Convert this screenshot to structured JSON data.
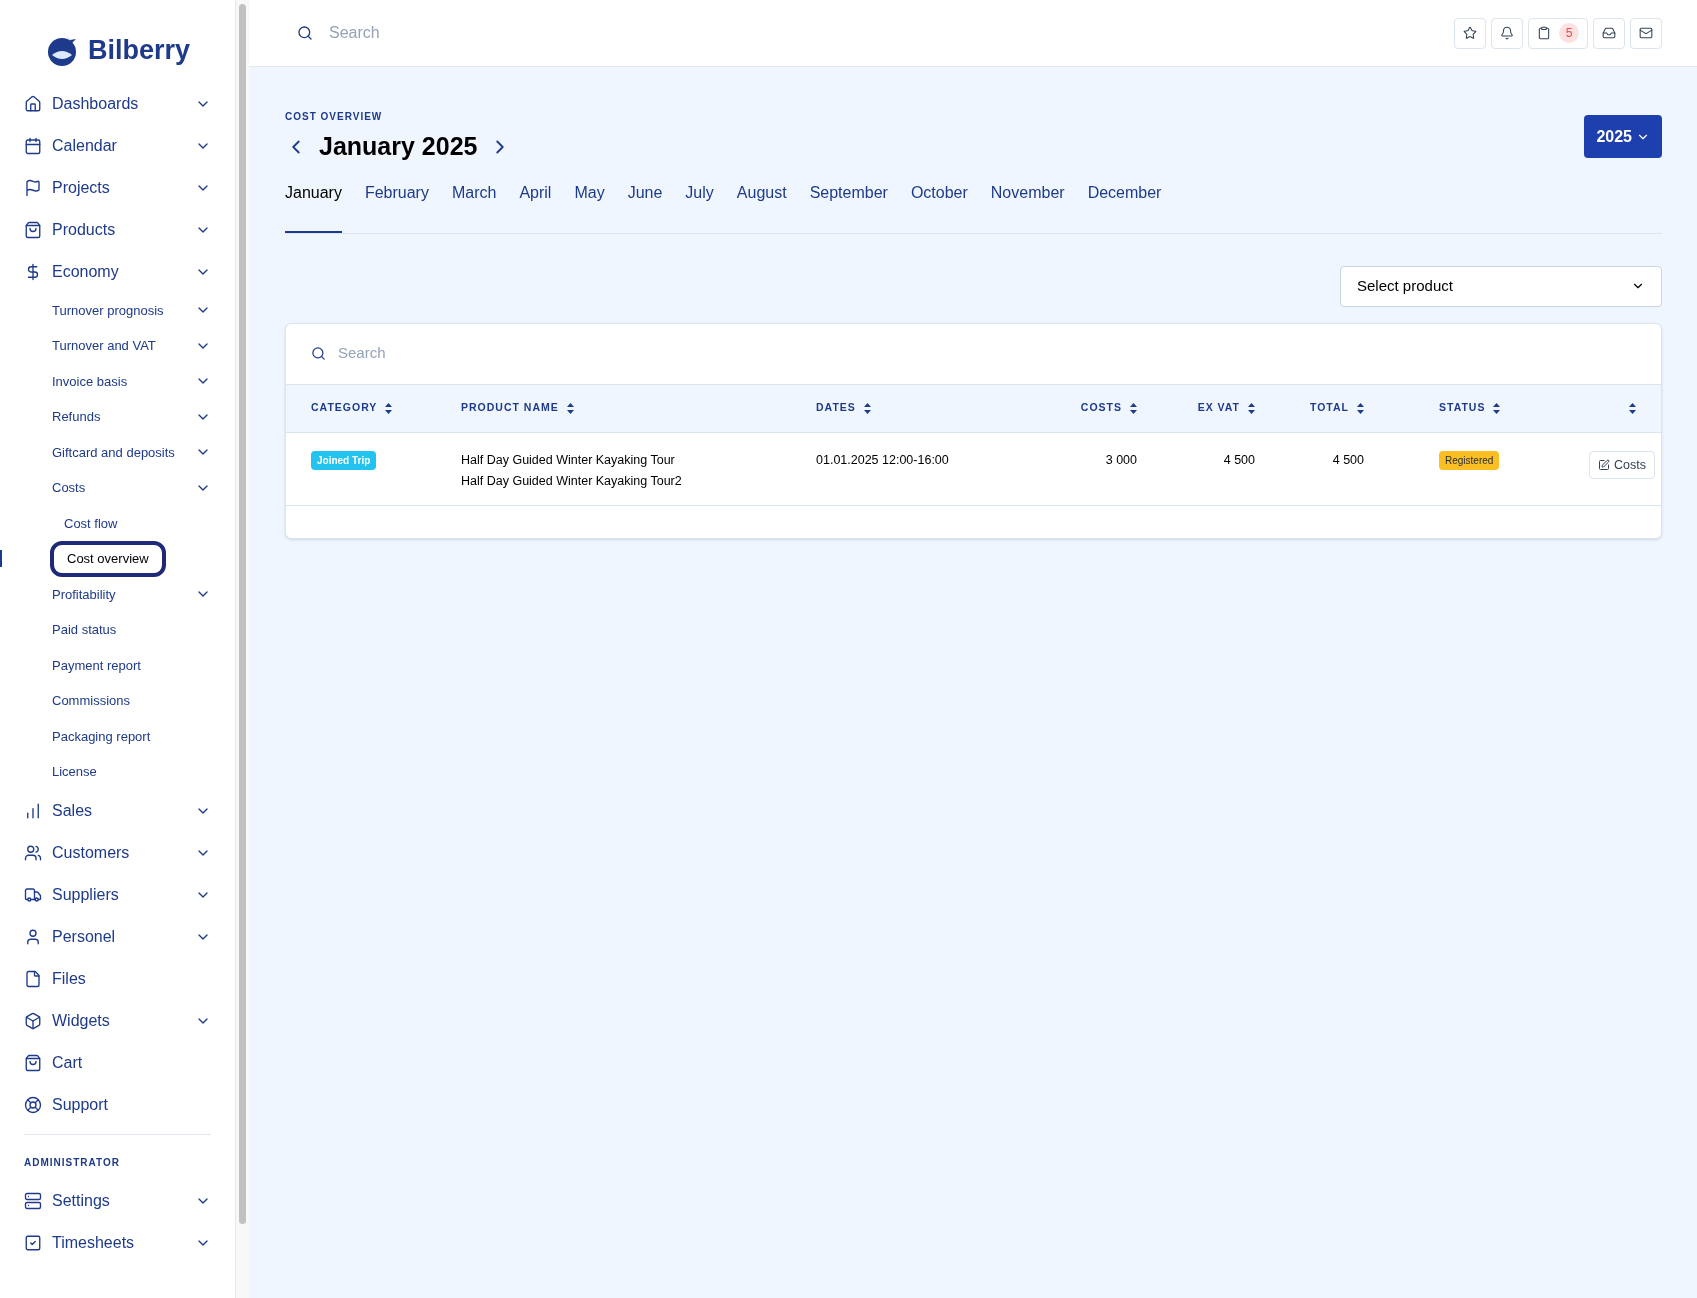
{
  "sidebar": {
    "logo": "Bilberry",
    "items": [
      {
        "kind": "home",
        "label": "Dashboards",
        "has_menu": true
      },
      {
        "kind": "calendar",
        "label": "Calendar",
        "has_menu": true
      },
      {
        "kind": "flag",
        "label": "Projects",
        "has_menu": true
      },
      {
        "kind": "bag",
        "label": "Products",
        "has_menu": true
      },
      {
        "kind": "dollar",
        "label": "Economy",
        "has_menu": true,
        "children": [
          {
            "label": "Turnover prognosis",
            "has_menu": true
          },
          {
            "label": "Turnover and VAT",
            "has_menu": true
          },
          {
            "label": "Invoice basis",
            "has_menu": true
          },
          {
            "label": "Refunds",
            "has_menu": true
          },
          {
            "label": "Giftcard and deposits",
            "has_menu": true
          },
          {
            "label": "Costs",
            "has_menu": true,
            "children": [
              {
                "label": "Cost flow",
                "selected": false
              },
              {
                "label": "Cost overview",
                "selected": true
              }
            ]
          },
          {
            "label": "Profitability",
            "has_menu": true
          },
          {
            "label": "Paid status",
            "has_menu": false
          },
          {
            "label": "Payment report",
            "has_menu": false
          },
          {
            "label": "Commissions",
            "has_menu": false
          },
          {
            "label": "Packaging report",
            "has_menu": false
          },
          {
            "label": "License",
            "has_menu": false
          }
        ]
      },
      {
        "kind": "chart",
        "label": "Sales",
        "has_menu": true
      },
      {
        "kind": "users",
        "label": "Customers",
        "has_menu": true
      },
      {
        "kind": "truck",
        "label": "Suppliers",
        "has_menu": true
      },
      {
        "kind": "user",
        "label": "Personel",
        "has_menu": true
      },
      {
        "kind": "file",
        "label": "Files",
        "has_menu": false
      },
      {
        "kind": "box",
        "label": "Widgets",
        "has_menu": true
      },
      {
        "kind": "bag",
        "label": "Cart",
        "has_menu": false
      },
      {
        "kind": "lifebuoy",
        "label": "Support",
        "has_menu": false
      }
    ],
    "section_label": "ADMINISTRATOR",
    "admin_items": [
      {
        "kind": "server",
        "label": "Settings",
        "has_menu": true
      },
      {
        "kind": "check",
        "label": "Timesheets",
        "has_menu": true
      }
    ]
  },
  "topbar": {
    "search_placeholder": "Search",
    "buttons": [
      {
        "kind": "star"
      },
      {
        "kind": "bell"
      },
      {
        "kind": "clipboard",
        "badge": "5"
      },
      {
        "kind": "inbox"
      },
      {
        "kind": "mail"
      }
    ]
  },
  "page": {
    "eyebrow": "COST OVERVIEW",
    "title": "January 2025",
    "year": "2025",
    "months": [
      {
        "label": "January",
        "selected": true
      },
      {
        "label": "February",
        "selected": false
      },
      {
        "label": "March",
        "selected": false
      },
      {
        "label": "April",
        "selected": false
      },
      {
        "label": "May",
        "selected": false
      },
      {
        "label": "June",
        "selected": false
      },
      {
        "label": "July",
        "selected": false
      },
      {
        "label": "August",
        "selected": false
      },
      {
        "label": "September",
        "selected": false
      },
      {
        "label": "October",
        "selected": false
      },
      {
        "label": "November",
        "selected": false
      },
      {
        "label": "December",
        "selected": false
      }
    ],
    "product_select": "Select product"
  },
  "table": {
    "search_placeholder": "Search",
    "columns": [
      "CATEGORY",
      "PRODUCT NAME",
      "DATES",
      "COSTS",
      "EX VAT",
      "TOTAL",
      "STATUS",
      ""
    ],
    "rows": [
      {
        "category": "Joined Trip",
        "names": [
          "Half Day Guided Winter Kayaking Tour",
          "Half Day Guided Winter Kayaking Tour2"
        ],
        "dates": "01.01.2025 12:00-16:00",
        "costs": "3 000",
        "ex_vat": "4 500",
        "total": "4 500",
        "status": "Registered",
        "action": "Costs"
      }
    ]
  }
}
